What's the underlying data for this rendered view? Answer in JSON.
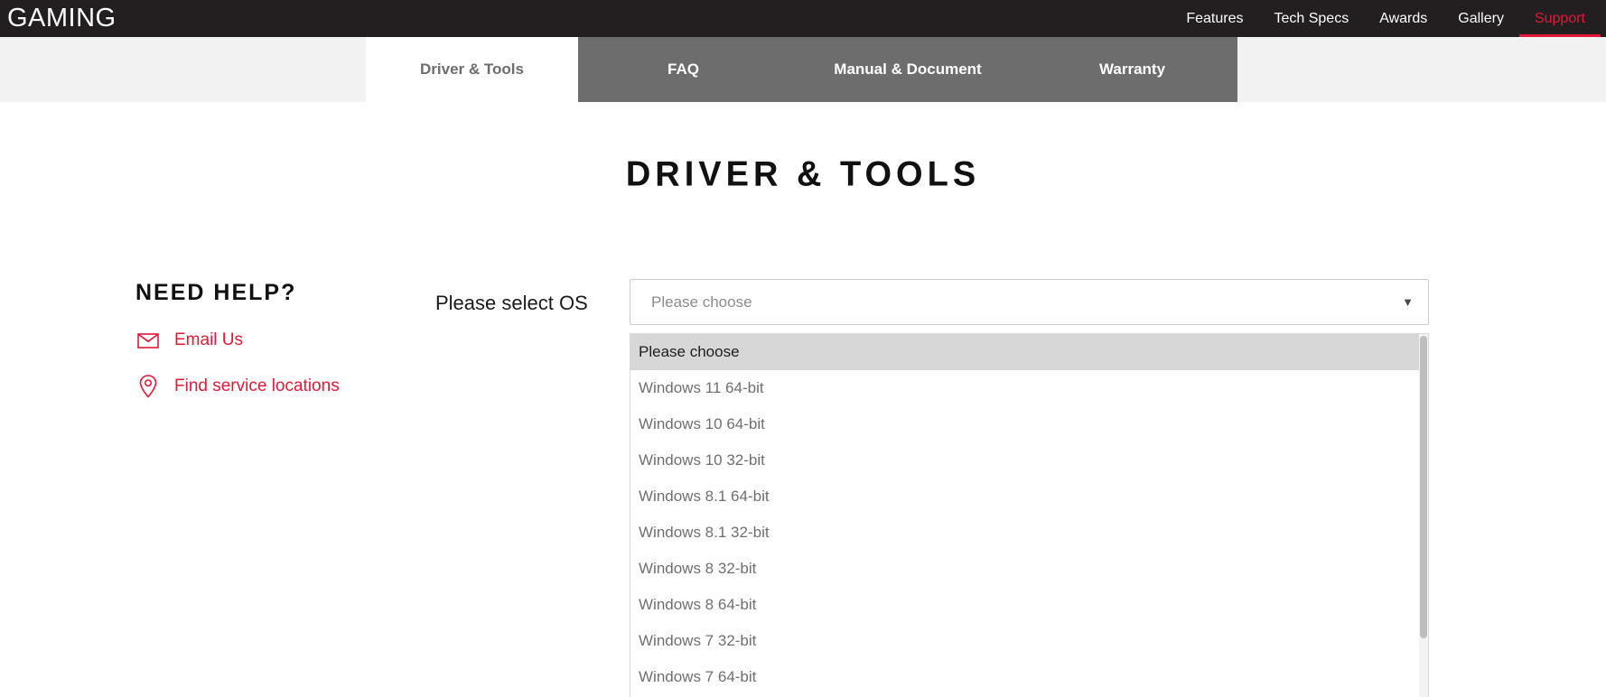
{
  "topbar": {
    "brand": "GAMING",
    "nav": [
      {
        "label": "Features",
        "active": false
      },
      {
        "label": "Tech Specs",
        "active": false
      },
      {
        "label": "Awards",
        "active": false
      },
      {
        "label": "Gallery",
        "active": false
      },
      {
        "label": "Support",
        "active": true
      }
    ]
  },
  "tabs": [
    {
      "label": "Driver & Tools",
      "active": true
    },
    {
      "label": "FAQ",
      "active": false
    },
    {
      "label": "Manual & Document",
      "active": false
    },
    {
      "label": "Warranty",
      "active": false
    }
  ],
  "page": {
    "title": "DRIVER & TOOLS"
  },
  "help": {
    "heading": "NEED HELP?",
    "links": [
      {
        "label": "Email Us",
        "icon": "email-icon"
      },
      {
        "label": "Find service locations",
        "icon": "location-pin-icon"
      }
    ]
  },
  "os_select": {
    "label": "Please select OS",
    "value": "Please choose",
    "caret": "▼",
    "selected_index": 0,
    "options": [
      "Please choose",
      "Windows 11 64-bit",
      "Windows 10 64-bit",
      "Windows 10 32-bit",
      "Windows 8.1 64-bit",
      "Windows 8.1 32-bit",
      "Windows 8 32-bit",
      "Windows 8 64-bit",
      "Windows 7 32-bit",
      "Windows 7 64-bit"
    ]
  },
  "colors": {
    "accent_red": "#e31837",
    "topbar_bg": "#231f20",
    "tab_bg": "#6d6d6d",
    "tab_strip_bg": "#f2f2f2",
    "highlight_row": "#d7d7d7"
  }
}
